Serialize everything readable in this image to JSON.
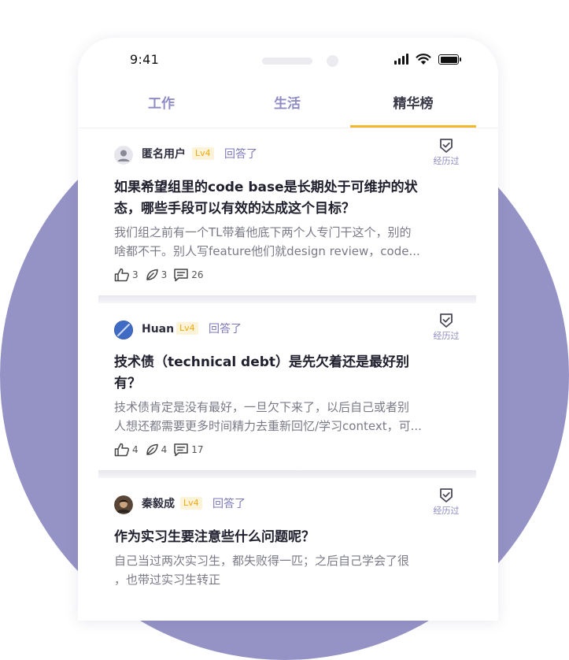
{
  "status_bar": {
    "time": "9:41"
  },
  "tabs": [
    {
      "label": "工作",
      "active": false
    },
    {
      "label": "生活",
      "active": false
    },
    {
      "label": "精华榜",
      "active": true
    }
  ],
  "posts": [
    {
      "author": "匿名用户",
      "level": "Lv4",
      "action": "回答了",
      "badge": "经历过",
      "title_lines": [
        "如果希望组里的code base是长期处于可维护的状",
        "态，哪些手段可以有效的达成这个目标？"
      ],
      "excerpt_lines": [
        "我们组之前有一个TL带着他底下两个人专门干这个，别的",
        "啥都不干。别人写feature他们就design review，code..."
      ],
      "likes": "3",
      "shares": "3",
      "comments": "26"
    },
    {
      "author": "Huan",
      "level": "Lv4",
      "action": "回答了",
      "badge": "经历过",
      "title_lines": [
        "技术债（technical debt）是先欠着还是最好别",
        "有？"
      ],
      "excerpt_lines": [
        "技术债肯定是没有最好，一旦欠下来了，以后自己或者别",
        "人想还都需要更多时间精力去重新回忆/学习context，可..."
      ],
      "likes": "4",
      "shares": "4",
      "comments": "17"
    },
    {
      "author": "秦毅成",
      "level": "Lv4",
      "action": "回答了",
      "badge": "经历过",
      "title_lines": [
        "作为实习生要注意些什么问题呢？"
      ],
      "excerpt_lines": [
        "自己当过两次实习生，都失败得一匹；之后自己学会了很",
        "，也带过实习生转正"
      ]
    }
  ],
  "colors": {
    "background_circle": "#9593c6",
    "tab_inactive": "#8f8bc4",
    "tab_indicator": "#f5b72b",
    "level_text": "#f1a914",
    "action_text": "#7d79b8"
  }
}
